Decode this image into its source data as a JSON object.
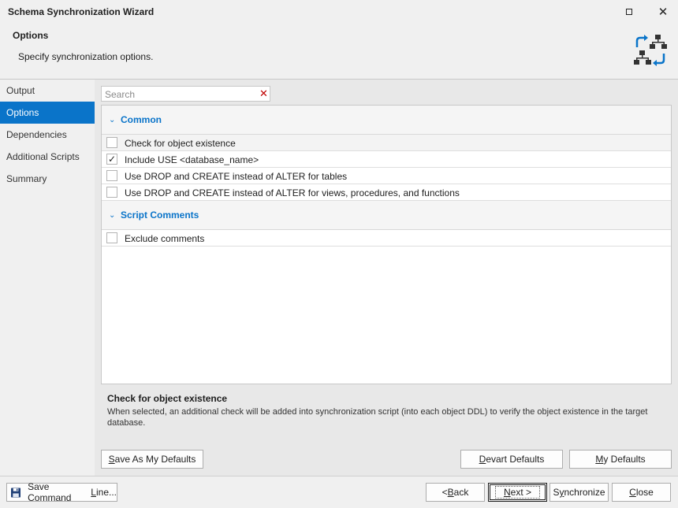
{
  "window": {
    "title": "Schema Synchronization Wizard"
  },
  "header": {
    "title": "Options",
    "subtitle": "Specify synchronization options."
  },
  "sidebar": {
    "items": [
      {
        "label": "Output",
        "active": false
      },
      {
        "label": "Options",
        "active": true
      },
      {
        "label": "Dependencies",
        "active": false
      },
      {
        "label": "Additional Scripts",
        "active": false
      },
      {
        "label": "Summary",
        "active": false
      }
    ]
  },
  "search": {
    "placeholder": "Search",
    "value": ""
  },
  "groups": [
    {
      "label": "Common",
      "options": [
        {
          "label": "Check for object existence",
          "checked": false
        },
        {
          "label": "Include USE <database_name>",
          "checked": true
        },
        {
          "label": "Use DROP and CREATE instead of ALTER for tables",
          "checked": false
        },
        {
          "label": "Use DROP and CREATE instead of ALTER for views, procedures, and functions",
          "checked": false
        }
      ]
    },
    {
      "label": "Script Comments",
      "options": [
        {
          "label": "Exclude comments",
          "checked": false
        }
      ]
    }
  ],
  "description": {
    "title": "Check for object existence",
    "text": "When selected, an additional check will be added into synchronization script (into each object DDL) to verify the object existence in the target database."
  },
  "buttons": {
    "save_defaults": {
      "pre": "",
      "key": "S",
      "post": "ave As My Defaults"
    },
    "devart_defaults": {
      "pre": "",
      "key": "D",
      "post": "evart Defaults"
    },
    "my_defaults": {
      "pre": "",
      "key": "M",
      "post": "y Defaults"
    },
    "save_command_line": {
      "pre": "Save Command ",
      "key": "L",
      "post": "ine..."
    },
    "back": {
      "pre": "< ",
      "key": "B",
      "post": "ack"
    },
    "next": {
      "pre": "",
      "key": "N",
      "post": "ext >"
    },
    "synchronize": {
      "pre": "S",
      "key": "y",
      "post": "nchronize"
    },
    "close": {
      "pre": "",
      "key": "C",
      "post": "lose"
    }
  },
  "colors": {
    "accent": "#0a74c9",
    "clear_x": "#c00000"
  },
  "icons": {
    "header": "schema-sync-icon",
    "save": "floppy-disk-icon",
    "search_clear": "clear-x-icon"
  }
}
